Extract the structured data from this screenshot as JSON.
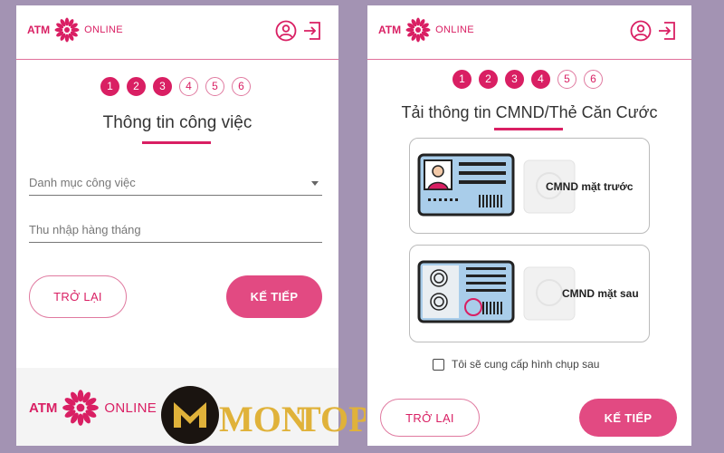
{
  "brand": {
    "atm": "ATM",
    "online": "ONLINE"
  },
  "left": {
    "steps": [
      "1",
      "2",
      "3",
      "4",
      "5",
      "6"
    ],
    "active_steps": 3,
    "title": "Thông tin công việc",
    "fields": {
      "job_category": "Danh mục công việc",
      "monthly_income": "Thu nhập hàng tháng"
    },
    "back_label": "TRỞ LẠI",
    "next_label": "KẾ TIẾP"
  },
  "right": {
    "steps": [
      "1",
      "2",
      "3",
      "4",
      "5",
      "6"
    ],
    "active_steps": 4,
    "title": "Tải thông tin CMND/Thẻ Căn Cước",
    "front_label": "CMND mặt trước",
    "back_card_label": "CMND mặt sau",
    "checkbox_label": "Tôi sẽ cung cấp hình chụp sau",
    "back_label": "TRỞ LẠI",
    "next_label": "KẾ TIẾP"
  },
  "watermark": {
    "text_mon": "MON",
    "text_top": "TOP"
  },
  "colors": {
    "brand": "#d91f63",
    "background": "#a393b3"
  }
}
